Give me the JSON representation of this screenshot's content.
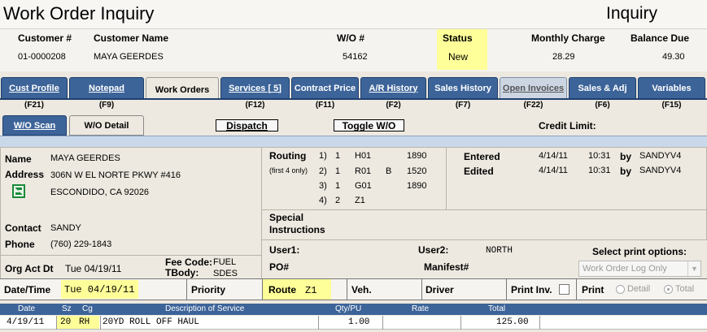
{
  "header": {
    "app_title": "Work Order Inquiry",
    "mode": "Inquiry"
  },
  "customer": {
    "labels": {
      "number": "Customer #",
      "name": "Customer Name",
      "wo": "W/O #",
      "status": "Status",
      "monthly": "Monthly Charge",
      "balance": "Balance Due"
    },
    "number": "01-0000208",
    "name": "MAYA GEERDES",
    "wo": "54162",
    "status": "New",
    "monthly": "28.29",
    "balance": "49.30"
  },
  "tabs": [
    {
      "label": "Cust Profile",
      "fkey": "(F21)"
    },
    {
      "label": "Notepad",
      "fkey": "(F9)"
    },
    {
      "label": "Work Orders",
      "fkey": ""
    },
    {
      "label": "Services [   5]",
      "fkey": "(F12)"
    },
    {
      "label": "Contract Price",
      "fkey": "(F11)"
    },
    {
      "label": "A/R History",
      "fkey": "(F2)"
    },
    {
      "label": "Sales History",
      "fkey": "(F7)"
    },
    {
      "label": "Open Invoices",
      "fkey": "(F22)"
    },
    {
      "label": "Sales & Adj",
      "fkey": "(F6)"
    },
    {
      "label": "Variables",
      "fkey": "(F15)"
    }
  ],
  "subtabs": {
    "wo_scan": "W/O Scan",
    "wo_detail": "W/O Detail"
  },
  "buttons": {
    "dispatch": "Dispatch",
    "toggle": "Toggle W/O"
  },
  "credit_limit_label": "Credit Limit:",
  "detail": {
    "name_label": "Name",
    "name": "MAYA GEERDES",
    "address_label": "Address",
    "address1": "306N W EL NORTE PKWY #416",
    "address2": "ESCONDIDO, CA 92026",
    "contact_label": "Contact",
    "contact": "SANDY",
    "phone_label": "Phone",
    "phone": "(760) 229-1843",
    "org_act_label": "Org Act Dt",
    "org_act": "Tue 04/19/11",
    "fee_code_label": "Fee Code:",
    "fee_code": "FUEL",
    "tbody_label": "TBody:",
    "tbody": "SDES"
  },
  "routing": {
    "label": "Routing",
    "sub": "(first 4 only)",
    "rows": [
      {
        "n": "1)",
        "a": "1",
        "code": "H01",
        "flag": "",
        "num": "1890"
      },
      {
        "n": "2)",
        "a": "1",
        "code": "R01",
        "flag": "B",
        "num": "1520"
      },
      {
        "n": "3)",
        "a": "1",
        "code": "G01",
        "flag": "",
        "num": "1890"
      },
      {
        "n": "4)",
        "a": "2",
        "code": "Z1",
        "flag": "",
        "num": ""
      }
    ]
  },
  "entry": {
    "entered_label": "Entered",
    "entered_date": "4/14/11",
    "entered_time": "10:31",
    "entered_by_label": "by",
    "entered_by": "SANDYV4",
    "edited_label": "Edited",
    "edited_date": "4/14/11",
    "edited_time": "10:31",
    "edited_by_label": "by",
    "edited_by": "SANDYV4"
  },
  "special": {
    "label1": "Special",
    "label2": "Instructions"
  },
  "users": {
    "user1_label": "User1:",
    "user2_label": "User2:",
    "user2": "NORTH",
    "po_label": "PO#",
    "manifest_label": "Manifest#"
  },
  "print_options": {
    "label": "Select print options:",
    "selected": "Work Order Log Only"
  },
  "action_row": {
    "date_label": "Date/Time",
    "date": "Tue 04/19/11",
    "priority_label": "Priority",
    "route_label": "Route",
    "route": "Z1",
    "veh_label": "Veh.",
    "driver_label": "Driver",
    "print_inv_label": "Print Inv.",
    "print_label": "Print",
    "detail_opt": "Detail",
    "total_opt": "Total"
  },
  "grid": {
    "headers": [
      "Date",
      "Sz",
      "Cg",
      "Description of Service",
      "Qty/PU",
      "Rate",
      "Total"
    ],
    "rows": [
      {
        "date": "4/19/11",
        "sz": "20",
        "cg": "RH",
        "desc": "20YD ROLL OFF HAUL",
        "qty": "1.00",
        "rate": "",
        "total": "125.00"
      }
    ]
  },
  "colors": {
    "tab_blue": "#3d6499",
    "highlight": "#ffff99",
    "background": "#ede9e0"
  }
}
